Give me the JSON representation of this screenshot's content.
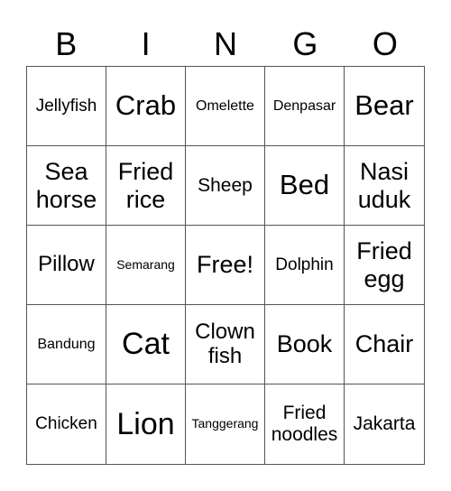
{
  "header": [
    "B",
    "I",
    "N",
    "G",
    "O"
  ],
  "cells": [
    {
      "text": "Jellyfish",
      "size": "s3"
    },
    {
      "text": "Crab",
      "size": "s7"
    },
    {
      "text": "Omelette",
      "size": "s2"
    },
    {
      "text": "Denpasar",
      "size": "s2"
    },
    {
      "text": "Bear",
      "size": "s7"
    },
    {
      "text": "Sea horse",
      "size": "s6"
    },
    {
      "text": "Fried rice",
      "size": "s6"
    },
    {
      "text": "Sheep",
      "size": "s4"
    },
    {
      "text": "Bed",
      "size": "s7"
    },
    {
      "text": "Nasi uduk",
      "size": "s6"
    },
    {
      "text": "Pillow",
      "size": "s5"
    },
    {
      "text": "Semarang",
      "size": "s1"
    },
    {
      "text": "Free!",
      "size": "s6"
    },
    {
      "text": "Dolphin",
      "size": "s3"
    },
    {
      "text": "Fried egg",
      "size": "s6"
    },
    {
      "text": "Bandung",
      "size": "s2"
    },
    {
      "text": "Cat",
      "size": "s8"
    },
    {
      "text": "Clown fish",
      "size": "s5"
    },
    {
      "text": "Book",
      "size": "s6"
    },
    {
      "text": "Chair",
      "size": "s6"
    },
    {
      "text": "Chicken",
      "size": "s3"
    },
    {
      "text": "Lion",
      "size": "s8"
    },
    {
      "text": "Tanggerang",
      "size": "s1"
    },
    {
      "text": "Fried noodles",
      "size": "s4"
    },
    {
      "text": "Jakarta",
      "size": "s4"
    }
  ]
}
